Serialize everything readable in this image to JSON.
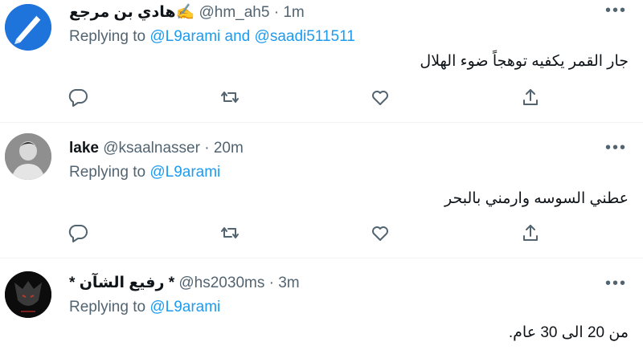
{
  "tweets": [
    {
      "name": "هادي بن مرجع✍️",
      "handle": "@hm_ah5",
      "time": "· 1m",
      "replying_prefix": "Replying to",
      "replying_to": "@L9arami and @saadi511511",
      "text": "جار القمر يكفيه توهجاً ضوء الهلال",
      "more": "•••"
    },
    {
      "name": "lake",
      "handle": "@ksaalnasser",
      "time": "· 20m",
      "replying_prefix": "Replying to",
      "replying_to": "@L9arami",
      "text": "عطني السوسه وارمني بالبحر",
      "more": "•••"
    },
    {
      "name": "* رفيع الشآن *",
      "handle": "@hs2030ms",
      "time": "· 3m",
      "replying_prefix": "Replying to",
      "replying_to": "@L9arami",
      "text": "من 20 الى 30 عام.",
      "more": "•••"
    }
  ],
  "icons": [
    "reply-icon",
    "retweet-icon",
    "like-icon",
    "share-icon",
    "more-icon"
  ],
  "colors": {
    "link": "#1d9bf0",
    "muted": "#536471",
    "text": "#0f1419",
    "divider": "#eff3f4"
  }
}
